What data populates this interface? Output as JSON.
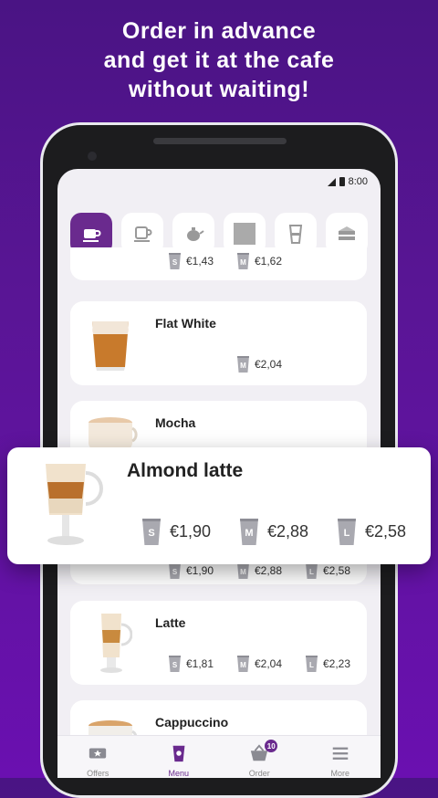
{
  "headline": {
    "line1": "Order in advance",
    "line2": "and get it at the cafe",
    "line3": "without waiting!"
  },
  "status": {
    "time": "8:00"
  },
  "categories": [
    {
      "icon": "coffee-cup-icon",
      "active": true
    },
    {
      "icon": "mug-icon",
      "active": false
    },
    {
      "icon": "teapot-icon",
      "active": false
    },
    {
      "icon": "square-icon",
      "active": false
    },
    {
      "icon": "glass-icon",
      "active": false
    },
    {
      "icon": "cake-icon",
      "active": false
    }
  ],
  "items": [
    {
      "name": "",
      "prices": [
        {
          "size": "S",
          "price": "€1,43"
        },
        {
          "size": "M",
          "price": "€1,62"
        }
      ]
    },
    {
      "name": "Flat White",
      "prices": [
        {
          "size": "M",
          "price": "€2,04"
        }
      ]
    },
    {
      "name": "Mocha",
      "prices": []
    },
    {
      "name": "",
      "prices": [
        {
          "size": "S",
          "price": "€1,90"
        },
        {
          "size": "M",
          "price": "€2,88"
        },
        {
          "size": "L",
          "price": "€2,58"
        }
      ]
    },
    {
      "name": "Latte",
      "prices": [
        {
          "size": "S",
          "price": "€1,81"
        },
        {
          "size": "M",
          "price": "€2,04"
        },
        {
          "size": "L",
          "price": "€2,23"
        }
      ]
    },
    {
      "name": "Cappuccino",
      "prices": []
    }
  ],
  "featured": {
    "name": "Almond latte",
    "prices": [
      {
        "size": "S",
        "price": "€1,90"
      },
      {
        "size": "M",
        "price": "€2,88"
      },
      {
        "size": "L",
        "price": "€2,58"
      }
    ]
  },
  "nav": [
    {
      "label": "Offers",
      "icon": "offers-icon"
    },
    {
      "label": "Menu",
      "icon": "menu-cup-icon",
      "active": true
    },
    {
      "label": "Order",
      "icon": "basket-icon",
      "badge": "10"
    },
    {
      "label": "More",
      "icon": "hamburger-icon"
    }
  ],
  "colors": {
    "accent": "#6a2a8e",
    "background": "#5a1596"
  }
}
